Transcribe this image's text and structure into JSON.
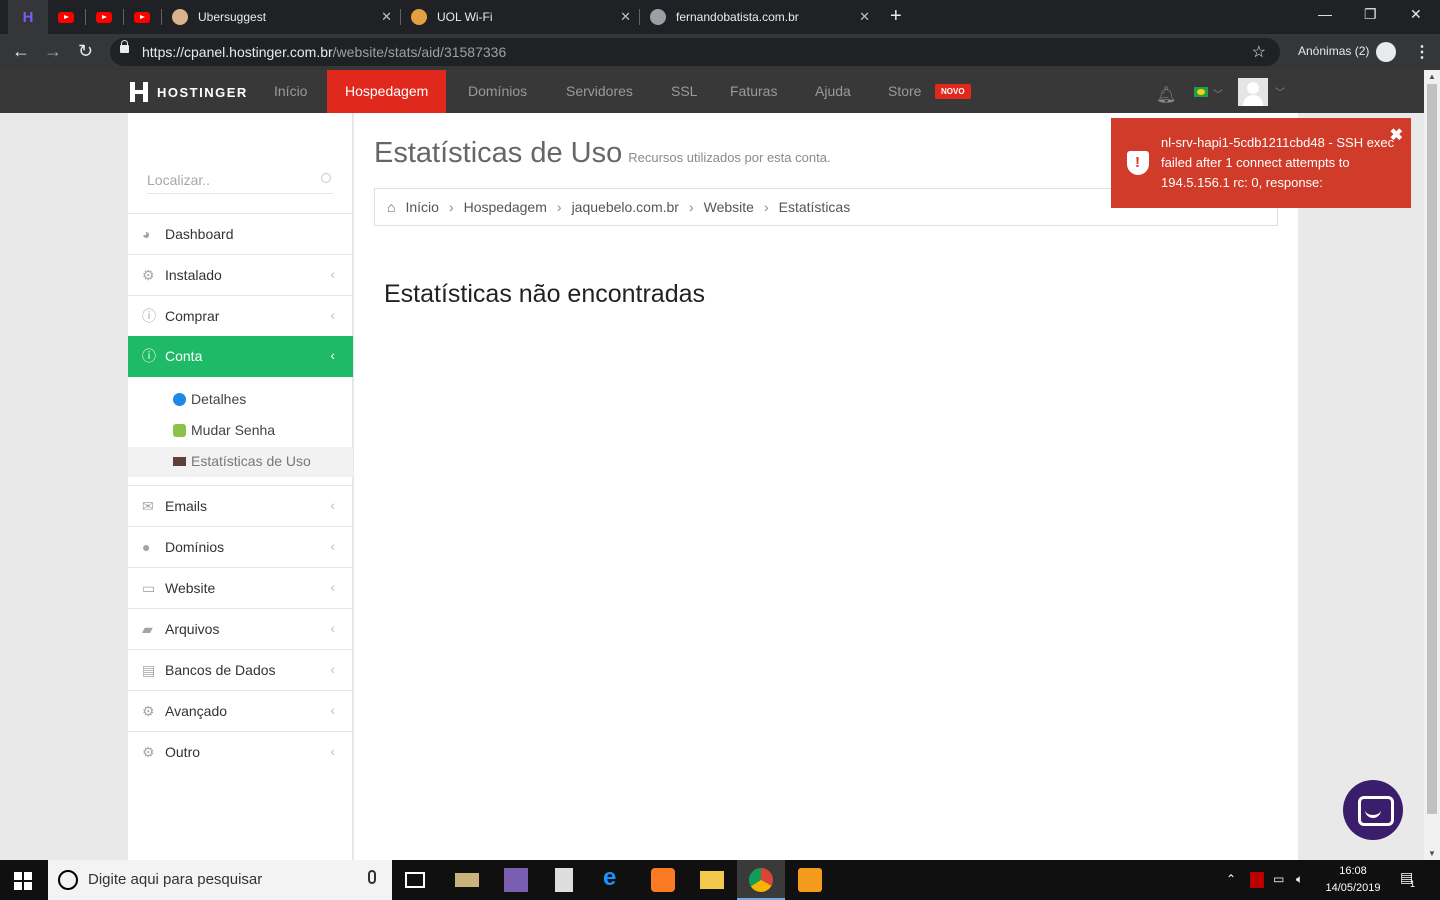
{
  "browser": {
    "tabs": [
      {
        "title": "Ubersuggest"
      },
      {
        "title": "UOL Wi-Fi"
      },
      {
        "title": "fernandobatista.com.br"
      }
    ],
    "new_tab_label": "+",
    "window_controls": {
      "minimize": "—",
      "restore": "❐",
      "close": "✕"
    },
    "url_host": "https://cpanel.hostinger.com.br",
    "url_path": "/website/stats/aid/31587336",
    "incognito_label": "Anónimas (2)"
  },
  "site_nav": {
    "brand": "HOSTINGER",
    "items": [
      {
        "label": "Início"
      },
      {
        "label": "Hospedagem"
      },
      {
        "label": "Domínios"
      },
      {
        "label": "Servidores"
      },
      {
        "label": "SSL"
      },
      {
        "label": "Faturas"
      },
      {
        "label": "Ajuda"
      },
      {
        "label": "Store"
      }
    ],
    "store_badge": "NOVO"
  },
  "sidebar": {
    "search_placeholder": "Localizar..",
    "items": [
      {
        "label": "Dashboard",
        "icon": "dashboard-icon"
      },
      {
        "label": "Instalado",
        "icon": "cogs-icon"
      },
      {
        "label": "Comprar",
        "icon": "info-icon"
      },
      {
        "label": "Conta",
        "icon": "info-icon"
      },
      {
        "label": "Emails",
        "icon": "envelope-icon"
      },
      {
        "label": "Domínios",
        "icon": "globe-icon"
      },
      {
        "label": "Website",
        "icon": "monitor-icon"
      },
      {
        "label": "Arquivos",
        "icon": "folder-icon"
      },
      {
        "label": "Bancos de Dados",
        "icon": "database-icon"
      },
      {
        "label": "Avançado",
        "icon": "cogs-icon"
      },
      {
        "label": "Outro",
        "icon": "gear-icon"
      }
    ],
    "sub_items": [
      {
        "label": "Detalhes",
        "icon": "info-circle-icon"
      },
      {
        "label": "Mudar Senha",
        "icon": "lock-icon"
      },
      {
        "label": "Estatísticas de Uso",
        "icon": "stats-icon"
      }
    ]
  },
  "main": {
    "title": "Estatísticas de Uso",
    "subtitle": "Recursos utilizados por esta conta.",
    "breadcrumb": [
      "Início",
      "Hospedagem",
      "jaquebelo.com.br",
      "Website",
      "Estatísticas"
    ],
    "message": "Estatísticas não encontradas"
  },
  "toast": {
    "message": "nl-srv-hapi1-5cdb1211cbd48 - SSH exec failed after 1 connect attempts to 194.5.156.1 rc: 0, response:",
    "close": "✖"
  },
  "taskbar": {
    "search_placeholder": "Digite aqui para pesquisar",
    "time": "16:08",
    "date": "14/05/2019",
    "notification_count": "1"
  },
  "colors": {
    "accent_red": "#e0281d",
    "active_green": "#1fba67",
    "toast_red": "#d13b2a",
    "chat_purple": "#3b1e6b"
  }
}
